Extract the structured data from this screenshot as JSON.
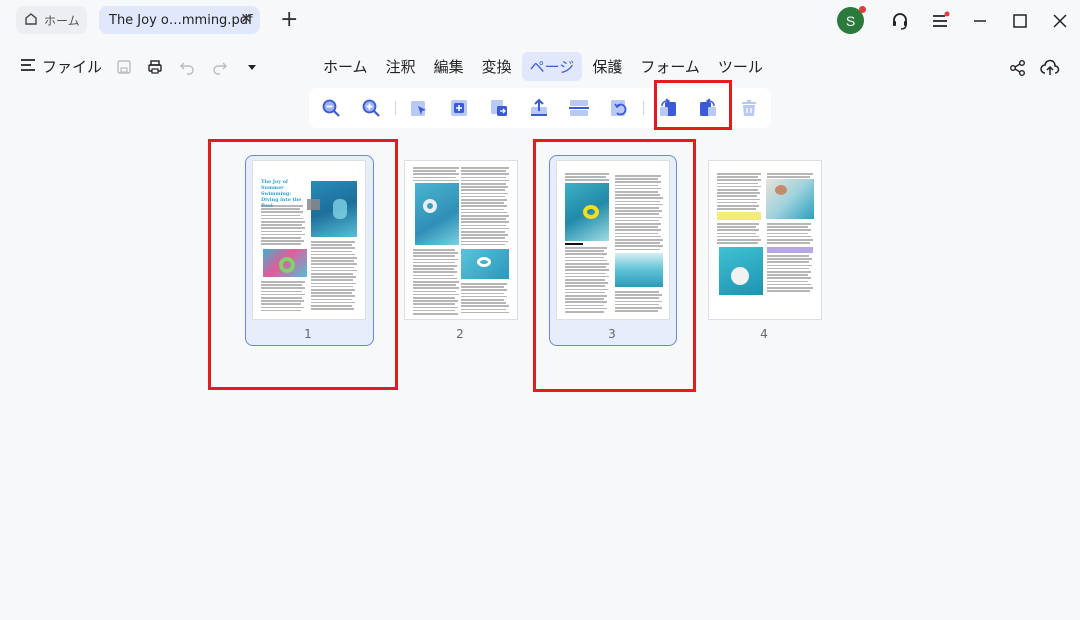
{
  "tabs": {
    "home_label": "ホーム",
    "doc_label": "The Joy o…mming.pdf"
  },
  "user": {
    "avatar_letter": "S"
  },
  "menu": {
    "file_label": "ファイル",
    "tabs": [
      "ホーム",
      "注釈",
      "編集",
      "変換",
      "ページ",
      "保護",
      "フォーム",
      "ツール"
    ],
    "active_tab": "ページ"
  },
  "page_toolbar": {
    "tools": [
      "zoom-out",
      "zoom-in",
      "select",
      "insert-page",
      "replace-page",
      "extract-page",
      "split-page",
      "rotate",
      "rotate-left",
      "rotate-right",
      "delete-page"
    ]
  },
  "pages": [
    {
      "number": "1",
      "selected": true,
      "title": "The Joy of Summer Swimming: Diving into the Pool"
    },
    {
      "number": "2",
      "selected": false
    },
    {
      "number": "3",
      "selected": true
    },
    {
      "number": "4",
      "selected": false
    }
  ],
  "colors": {
    "accent": "#3a5bd9",
    "highlight": "#e31b1b",
    "avatar": "#2a7a3b"
  }
}
